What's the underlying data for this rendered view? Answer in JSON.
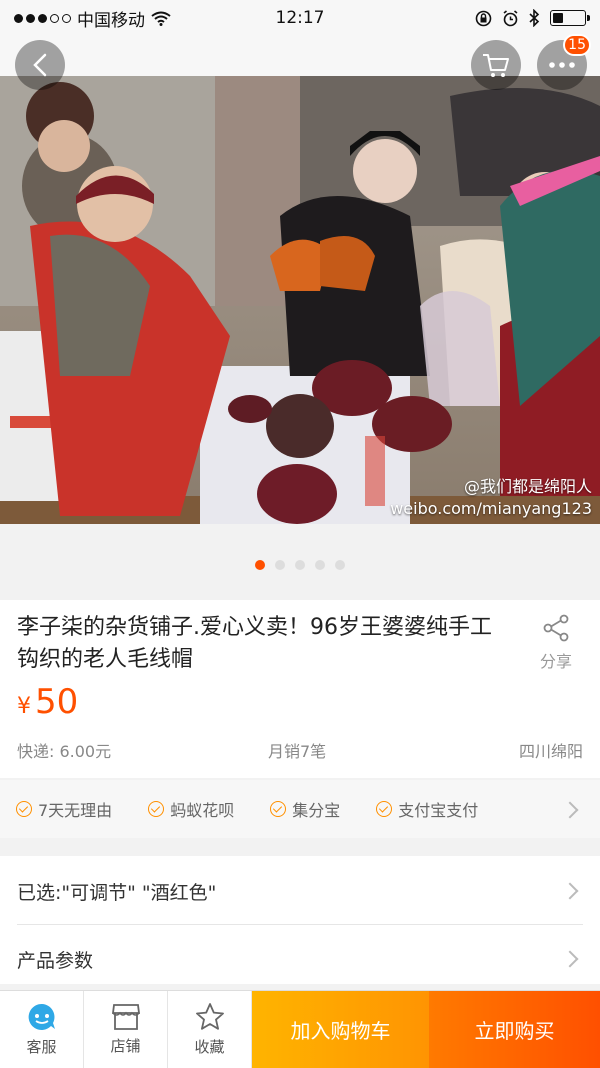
{
  "status_bar": {
    "carrier": "中国移动",
    "time": "12:17",
    "battery_level": 0.35
  },
  "header": {
    "notification_count": "15"
  },
  "photo": {
    "watermark_handle": "@我们都是绵阳人",
    "watermark_url": "weibo.com/mianyang123",
    "active_slide": 1,
    "slide_count": 5
  },
  "product": {
    "title": "李子柒的杂货铺子.爱心义卖！96岁王婆婆纯手工钩织的老人毛线帽",
    "share_label": "分享",
    "currency": "¥",
    "price": "50",
    "shipping": "快递: 6.00元",
    "monthly_sales": "月销7笔",
    "location": "四川绵阳"
  },
  "services": [
    "7天无理由",
    "蚂蚁花呗",
    "集分宝",
    "支付宝支付"
  ],
  "selection": {
    "label": "已选:\"可调节\" \"酒红色\""
  },
  "params": {
    "label": "产品参数"
  },
  "bottom_bar": {
    "customer_service": "客服",
    "shop": "店铺",
    "favorite": "收藏",
    "add_to_cart": "加入购物车",
    "buy_now": "立即购买"
  },
  "colors": {
    "accent": "#ff5000",
    "cart_button": "#ffa500",
    "buy_button": "#ff5000"
  }
}
